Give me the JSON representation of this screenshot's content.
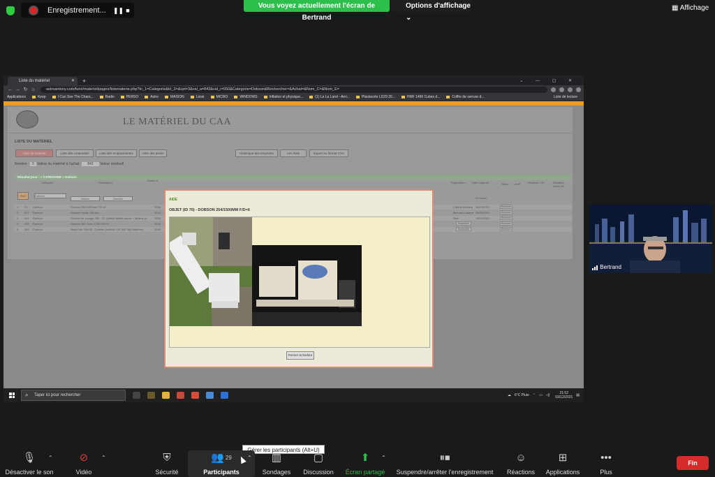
{
  "zoom": {
    "recording_label": "Enregistrement...",
    "share_banner": "Vous voyez actuellement l'écran de Bertrand",
    "view_options": "Options d'affichage",
    "display_button": "Affichage",
    "participant_name": "Bertrand",
    "participants_count": "29",
    "tooltip": "Gérer les participants (Alt+U)",
    "toolbar": {
      "mute": "Désactiver le son",
      "video": "Vidéo",
      "security": "Sécurité",
      "participants": "Participants",
      "polls": "Sondages",
      "chat": "Discussion",
      "share": "Écran partagé",
      "record": "Suspendre/arrêter l'enregistrement",
      "reactions": "Réactions",
      "apps": "Applications",
      "more": "Plus",
      "end": "Fin"
    }
  },
  "browser": {
    "tab_title": "Liste du matériel",
    "url": "astroantony.com/furni/materiel/pages/listematerie.php?tn_1=Categorie&tri_2=&cpt=3&val_a=843&val_r=550&Categorie=Dobson&Rechercher=&Achat=&Nom_C=&Nom_E=",
    "bookmarks": [
      "Applications",
      "Keep",
      "I Can See The Chars...",
      "Radio",
      "PERSO",
      "Astro",
      "MAISON",
      "Loisir",
      "MICRO",
      "WINDOWS",
      "Inflation et physique...",
      "(1) La La Land - Aeri...",
      "Plastacote LD29 20...",
      "HMF 1456 Cubes d...",
      "Coffre de serrure d..."
    ],
    "reading_list": "Liste de lecture"
  },
  "site": {
    "title": "LE MATÉRIEL DU CAA",
    "list_title": "LISTE DU MATÉRIEL",
    "buttons": [
      "Liste du matériel",
      "Liste des contenants",
      "Liste des emplacements",
      "Liste des packs",
      "Historique des emprunts",
      "Les états",
      "Export au format CSV"
    ],
    "nombre_label": "Nombre :",
    "nombre_value": "5",
    "achat_label": "Valeur du matériel à l'achat :",
    "achat_value": "843",
    "residuel_label": "Valeur résiduell",
    "filter_header": "Résultat pour : « CATÉGORIE » Dobson",
    "col_categorie": "Catégorie",
    "col_description": "Description",
    "col_annee": "Année d",
    "col_emprunteur": "Emprunteur",
    "col_date_emprunt": "Date emprunt",
    "col_resa": "Résa",
    "col_actif": "Actif",
    "col_situation": "Situation / 2E",
    "col_situation2": "Situation futurs 2E",
    "raz": "RAZ",
    "filter_select": "Dobson",
    "valider": "Valider",
    "annuler": "Annuler",
    "en_cours": "En cours",
    "rows": [
      {
        "n": "1",
        "id": "70",
        "cat": "Dobson",
        "desc": "Dobson 254/1500mm F/D=6",
        "year": "2008",
        "emprunteur": "Claude Bernard",
        "date": "18/10/2021"
      },
      {
        "n": "2",
        "id": "517",
        "cat": "Dobson",
        "desc": "Dobson Hisale 150 mm",
        "year": "2014",
        "emprunteur": "Bernard Labarre",
        "date": "28/05/2021"
      },
      {
        "n": "3",
        "id": "344",
        "cat": "Dobson",
        "desc": "Dobson de voyage 250 - 33\" pliable tables caisse + tableau point rouge",
        "year": "2008",
        "emprunteur": "Rein",
        "date": "24/02/2021"
      },
      {
        "n": "4",
        "id": "339",
        "cat": "Dobson",
        "desc": "Dobson 350 Orion 1750 F/D=5",
        "year": "2008",
        "emprunteur": "",
        "date": ""
      },
      {
        "n": "5",
        "id": "349",
        "cat": "Dobson",
        "desc": "Baby Dob 76/450 - Dobson (vertical 120-300 Sky-Watcher)",
        "year": "2008",
        "emprunteur": "",
        "date": ""
      }
    ],
    "emprunter": "Emprunter",
    "reserver": "Réserver"
  },
  "modal": {
    "label": "AIDE",
    "object_title": "OBJET (ID 70) - DOBSON 254/1500MM F/D=6",
    "close": "Fermer la fenêtre"
  },
  "taskbar": {
    "search_placeholder": "Taper ici pour rechercher",
    "weather": "6°C Pluie",
    "time": "21:52",
    "date": "03/12/2021"
  },
  "colors": {
    "zoom_green": "#2dbf4b",
    "end_red": "#d62b2b",
    "modal_border": "#d98b78",
    "table_header": "#8fa88d",
    "orange_strip": "#f39a21"
  }
}
